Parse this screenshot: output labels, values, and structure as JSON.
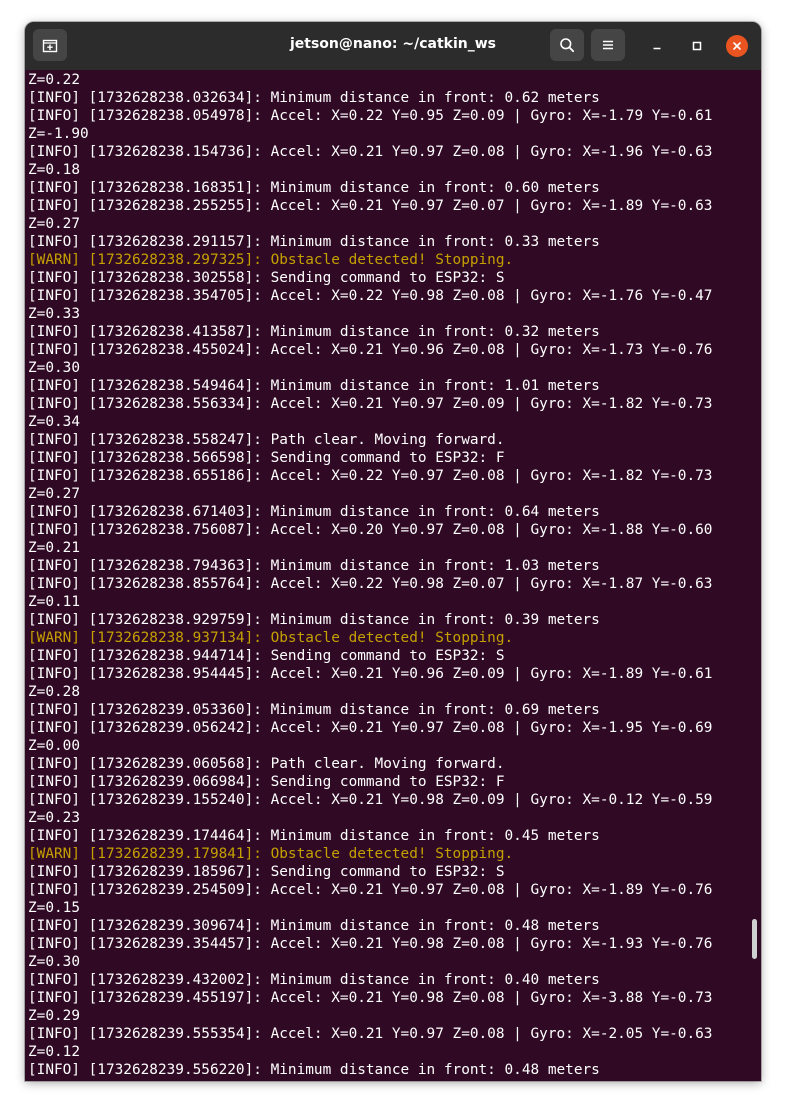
{
  "window": {
    "title": "jetson@nano: ~/catkin_ws"
  },
  "icons": {
    "new_tab": "new-tab-icon",
    "search": "search-icon",
    "menu": "hamburger-menu-icon",
    "minimize": "minimize-icon",
    "maximize": "maximize-icon",
    "close": "close-icon"
  },
  "colors": {
    "terminal_bg": "#300a24",
    "titlebar_bg": "#2c2c2c",
    "text": "#ffffff",
    "warn": "#c4a000",
    "close_button": "#e95420"
  },
  "terminal": {
    "lines": [
      {
        "level": "info",
        "text": "Z=0.22"
      },
      {
        "level": "info",
        "text": "[INFO] [1732628238.032634]: Minimum distance in front: 0.62 meters"
      },
      {
        "level": "info",
        "text": "[INFO] [1732628238.054978]: Accel: X=0.22 Y=0.95 Z=0.09 | Gyro: X=-1.79 Y=-0.61"
      },
      {
        "level": "info",
        "text": "Z=-1.90"
      },
      {
        "level": "info",
        "text": "[INFO] [1732628238.154736]: Accel: X=0.21 Y=0.97 Z=0.08 | Gyro: X=-1.96 Y=-0.63"
      },
      {
        "level": "info",
        "text": "Z=0.18"
      },
      {
        "level": "info",
        "text": "[INFO] [1732628238.168351]: Minimum distance in front: 0.60 meters"
      },
      {
        "level": "info",
        "text": "[INFO] [1732628238.255255]: Accel: X=0.21 Y=0.97 Z=0.07 | Gyro: X=-1.89 Y=-0.63"
      },
      {
        "level": "info",
        "text": "Z=0.27"
      },
      {
        "level": "info",
        "text": "[INFO] [1732628238.291157]: Minimum distance in front: 0.33 meters"
      },
      {
        "level": "warn",
        "text": "[WARN] [1732628238.297325]: Obstacle detected! Stopping."
      },
      {
        "level": "info",
        "text": "[INFO] [1732628238.302558]: Sending command to ESP32: S"
      },
      {
        "level": "info",
        "text": "[INFO] [1732628238.354705]: Accel: X=0.22 Y=0.98 Z=0.08 | Gyro: X=-1.76 Y=-0.47"
      },
      {
        "level": "info",
        "text": "Z=0.33"
      },
      {
        "level": "info",
        "text": "[INFO] [1732628238.413587]: Minimum distance in front: 0.32 meters"
      },
      {
        "level": "info",
        "text": "[INFO] [1732628238.455024]: Accel: X=0.21 Y=0.96 Z=0.08 | Gyro: X=-1.73 Y=-0.76"
      },
      {
        "level": "info",
        "text": "Z=0.30"
      },
      {
        "level": "info",
        "text": "[INFO] [1732628238.549464]: Minimum distance in front: 1.01 meters"
      },
      {
        "level": "info",
        "text": "[INFO] [1732628238.556334]: Accel: X=0.21 Y=0.97 Z=0.09 | Gyro: X=-1.82 Y=-0.73"
      },
      {
        "level": "info",
        "text": "Z=0.34"
      },
      {
        "level": "info",
        "text": "[INFO] [1732628238.558247]: Path clear. Moving forward."
      },
      {
        "level": "info",
        "text": "[INFO] [1732628238.566598]: Sending command to ESP32: F"
      },
      {
        "level": "info",
        "text": "[INFO] [1732628238.655186]: Accel: X=0.22 Y=0.97 Z=0.08 | Gyro: X=-1.82 Y=-0.73"
      },
      {
        "level": "info",
        "text": "Z=0.27"
      },
      {
        "level": "info",
        "text": "[INFO] [1732628238.671403]: Minimum distance in front: 0.64 meters"
      },
      {
        "level": "info",
        "text": "[INFO] [1732628238.756087]: Accel: X=0.20 Y=0.97 Z=0.08 | Gyro: X=-1.88 Y=-0.60"
      },
      {
        "level": "info",
        "text": "Z=0.21"
      },
      {
        "level": "info",
        "text": "[INFO] [1732628238.794363]: Minimum distance in front: 1.03 meters"
      },
      {
        "level": "info",
        "text": "[INFO] [1732628238.855764]: Accel: X=0.22 Y=0.98 Z=0.07 | Gyro: X=-1.87 Y=-0.63"
      },
      {
        "level": "info",
        "text": "Z=0.11"
      },
      {
        "level": "info",
        "text": "[INFO] [1732628238.929759]: Minimum distance in front: 0.39 meters"
      },
      {
        "level": "warn",
        "text": "[WARN] [1732628238.937134]: Obstacle detected! Stopping."
      },
      {
        "level": "info",
        "text": "[INFO] [1732628238.944714]: Sending command to ESP32: S"
      },
      {
        "level": "info",
        "text": "[INFO] [1732628238.954445]: Accel: X=0.21 Y=0.96 Z=0.09 | Gyro: X=-1.89 Y=-0.61"
      },
      {
        "level": "info",
        "text": "Z=0.28"
      },
      {
        "level": "info",
        "text": "[INFO] [1732628239.053360]: Minimum distance in front: 0.69 meters"
      },
      {
        "level": "info",
        "text": "[INFO] [1732628239.056242]: Accel: X=0.21 Y=0.97 Z=0.08 | Gyro: X=-1.95 Y=-0.69"
      },
      {
        "level": "info",
        "text": "Z=0.00"
      },
      {
        "level": "info",
        "text": "[INFO] [1732628239.060568]: Path clear. Moving forward."
      },
      {
        "level": "info",
        "text": "[INFO] [1732628239.066984]: Sending command to ESP32: F"
      },
      {
        "level": "info",
        "text": "[INFO] [1732628239.155240]: Accel: X=0.21 Y=0.98 Z=0.09 | Gyro: X=-0.12 Y=-0.59"
      },
      {
        "level": "info",
        "text": "Z=0.23"
      },
      {
        "level": "info",
        "text": "[INFO] [1732628239.174464]: Minimum distance in front: 0.45 meters"
      },
      {
        "level": "warn",
        "text": "[WARN] [1732628239.179841]: Obstacle detected! Stopping."
      },
      {
        "level": "info",
        "text": "[INFO] [1732628239.185967]: Sending command to ESP32: S"
      },
      {
        "level": "info",
        "text": "[INFO] [1732628239.254509]: Accel: X=0.21 Y=0.97 Z=0.08 | Gyro: X=-1.89 Y=-0.76"
      },
      {
        "level": "info",
        "text": "Z=0.15"
      },
      {
        "level": "info",
        "text": "[INFO] [1732628239.309674]: Minimum distance in front: 0.48 meters"
      },
      {
        "level": "info",
        "text": "[INFO] [1732628239.354457]: Accel: X=0.21 Y=0.98 Z=0.08 | Gyro: X=-1.93 Y=-0.76"
      },
      {
        "level": "info",
        "text": "Z=0.30"
      },
      {
        "level": "info",
        "text": "[INFO] [1732628239.432002]: Minimum distance in front: 0.40 meters"
      },
      {
        "level": "info",
        "text": "[INFO] [1732628239.455197]: Accel: X=0.21 Y=0.98 Z=0.08 | Gyro: X=-3.88 Y=-0.73"
      },
      {
        "level": "info",
        "text": "Z=0.29"
      },
      {
        "level": "info",
        "text": "[INFO] [1732628239.555354]: Accel: X=0.21 Y=0.97 Z=0.08 | Gyro: X=-2.05 Y=-0.63"
      },
      {
        "level": "info",
        "text": "Z=0.12"
      },
      {
        "level": "info",
        "text": "[INFO] [1732628239.556220]: Minimum distance in front: 0.48 meters"
      }
    ]
  }
}
